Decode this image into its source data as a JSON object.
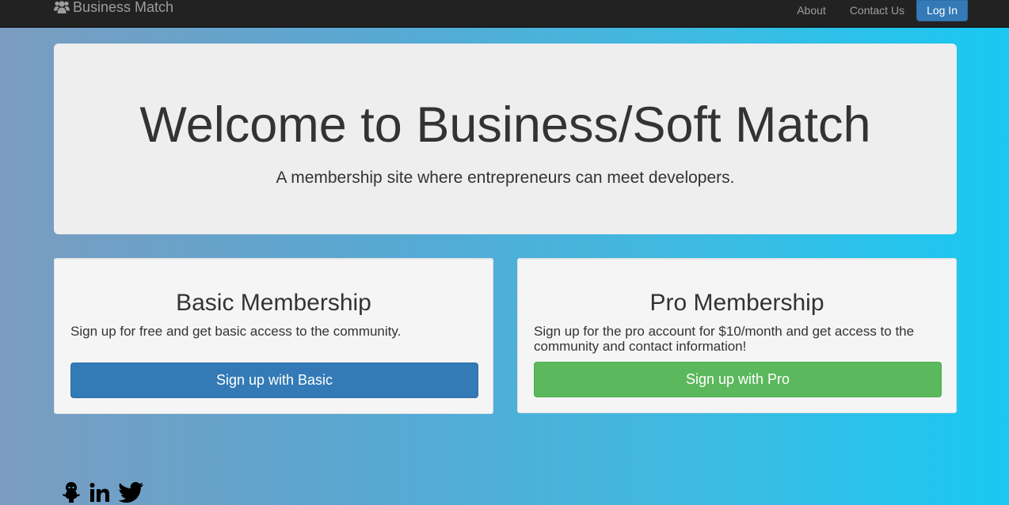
{
  "navbar": {
    "brand": "Business Match",
    "brand_icon": "users-icon",
    "links": [
      "About",
      "Contact Us"
    ],
    "login_label": "Log In"
  },
  "hero": {
    "title": "Welcome to Business/Soft Match",
    "subtitle": "A membership site where entrepreneurs can meet developers."
  },
  "cards": [
    {
      "title": "Basic Membership",
      "description": "Sign up for free and get basic access to the community.",
      "button": "Sign up with Basic",
      "button_color": "#337ab7"
    },
    {
      "title": "Pro Membership",
      "description": "Sign up for the pro account for $10/month and get access to the community and contact information!",
      "button": "Sign up with Pro",
      "button_color": "#5cb85c"
    }
  ],
  "footer": {
    "social_icons": [
      "github-icon",
      "linkedin-icon",
      "twitter-icon"
    ]
  }
}
